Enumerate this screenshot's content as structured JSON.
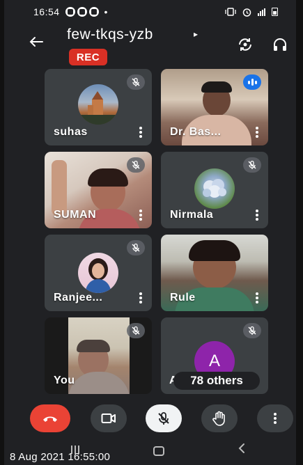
{
  "status_bar": {
    "time": "16:54",
    "dot": "•"
  },
  "header": {
    "meeting_code": "few-tkqs-yzb",
    "caret": "▸",
    "rec_label": "REC"
  },
  "participants": [
    {
      "name": "suhas",
      "mic": "muted",
      "kind": "avatar"
    },
    {
      "name": "Dr. Bas...",
      "mic": "speaking",
      "kind": "video"
    },
    {
      "name": "SUMAN",
      "mic": "muted",
      "kind": "video"
    },
    {
      "name": "Nirmala",
      "mic": "muted",
      "kind": "avatar"
    },
    {
      "name": "Ranjee...",
      "mic": "muted",
      "kind": "avatar"
    },
    {
      "name": "Rule",
      "mic": "unmuted",
      "kind": "video"
    },
    {
      "name": "You",
      "mic": "muted",
      "kind": "video"
    }
  ],
  "others_tile": {
    "avatar_letter": "A",
    "partial_name": "A",
    "others_label": "78 others",
    "avatar_color": "#8e24aa"
  },
  "controls": {
    "end_call_color": "#ea4335",
    "mic_state": "muted"
  },
  "footer": {
    "timestamp": "8 Aug 2021 16:55:00"
  },
  "colors": {
    "background": "#202124",
    "tile": "#3c4043",
    "rec": "#d93025",
    "speaking": "#1a73e8"
  }
}
